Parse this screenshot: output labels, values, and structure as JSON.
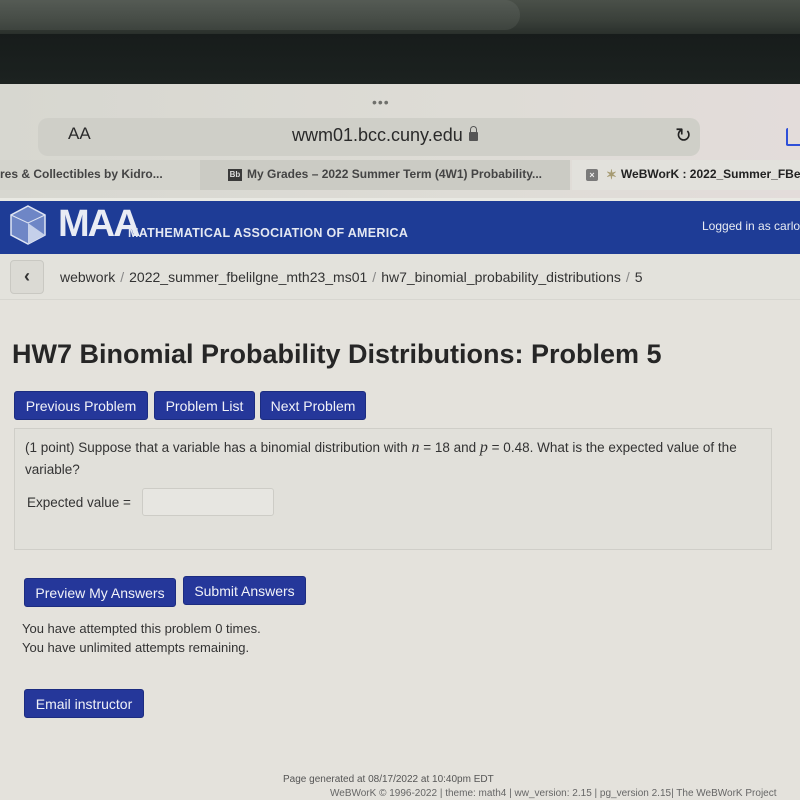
{
  "browser": {
    "more_dots": "•••",
    "text_size_label": "AA",
    "url": "wwm01.bcc.cuny.edu",
    "tabs": [
      {
        "label": "res & Collectibles by Kidro...",
        "icon": "none"
      },
      {
        "label": "My Grades – 2022 Summer Term (4W1) Probability...",
        "icon": "blackboard-icon",
        "icon_text": "Bb"
      },
      {
        "label": "WeBWorK : 2022_Summer_FBe",
        "icon": "webwork-star-icon",
        "close": "×",
        "active": true
      }
    ]
  },
  "banner": {
    "logo_text": "MAA",
    "org_name": "MATHEMATICAL ASSOCIATION OF AMERICA",
    "logged_in": "Logged in as carlos"
  },
  "breadcrumb": {
    "back": "‹",
    "items": [
      "webwork",
      "2022_summer_fbelilgne_mth23_ms01",
      "hw7_binomial_probability_distributions",
      "5"
    ],
    "separator": "/"
  },
  "page": {
    "title": "HW7 Binomial Probability Distributions: Problem 5",
    "nav": {
      "previous": "Previous Problem",
      "list": "Problem List",
      "next": "Next Problem"
    }
  },
  "problem": {
    "text_1": "(1 point) Suppose that a variable has a binomial distribution with ",
    "var_n": "n",
    "text_2": " = 18 and ",
    "var_p": "p",
    "text_3": " = 0.48. What is the expected value of the variable?",
    "answer_label": "Expected value =",
    "answer_value": ""
  },
  "actions": {
    "preview": "Preview My Answers",
    "submit": "Submit Answers",
    "attempts": "You have attempted this problem 0 times.",
    "remaining": "You have unlimited attempts remaining.",
    "email": "Email instructor"
  },
  "footer": {
    "generated": "Page generated at 08/17/2022 at 10:40pm EDT",
    "version": "WeBWorK © 1996-2022 | theme: math4 | ww_version: 2.15 | pg_version 2.15| The WeBWorK Project"
  },
  "colors": {
    "banner": "#1e3c96",
    "button": "#25379a"
  }
}
